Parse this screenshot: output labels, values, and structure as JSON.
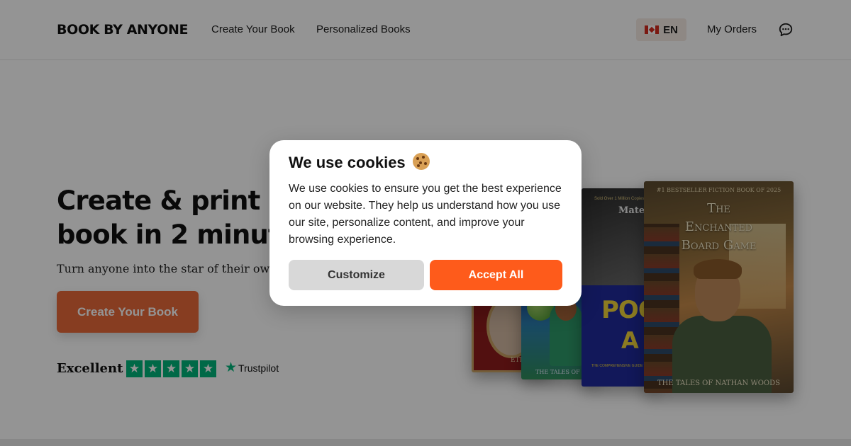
{
  "header": {
    "logo": "BOOK BY ANYONE",
    "nav": [
      "Create Your Book",
      "Personalized Books"
    ],
    "language": "EN",
    "flag_icon": "canada-flag-icon",
    "my_orders": "My Orders",
    "chat_icon": "chat-bubble-icon"
  },
  "hero": {
    "title_line1": "Create & print a h",
    "title_line2": "book in 2 minutes",
    "subtitle": "Turn anyone into the star of their own p",
    "cta_label": "Create Your Book",
    "rating_label": "Excellent",
    "stars": 5,
    "trustpilot": "Trustpilot"
  },
  "books": {
    "red_cover_text": "ETI",
    "space_cover_text": "THE TALES OF",
    "poor_top_line": "Sold Over 1 Million Copies",
    "poor_mate": "Mate",
    "poor_title": "POOI",
    "poor_title_2": "A",
    "poor_small": "THE COMPREHENSIVE GUIDE TO",
    "main_badge": "#1 BESTSELLER FICTION BOOK OF 2025",
    "main_title_1": "The",
    "main_title_2": "Enchanted",
    "main_title_3": "Board Game",
    "main_footer": "THE TALES OF NATHAN WOODS"
  },
  "cookie_modal": {
    "title": "We use cookies",
    "icon": "cookie-icon",
    "body": "We use cookies to ensure you get the best experience on our website. They help us understand how you use our site, personalize content, and improve your browsing experience.",
    "customize_label": "Customize",
    "accept_label": "Accept All"
  },
  "colors": {
    "accent": "#fe5b1b",
    "cta": "#e86a3a",
    "trustpilot_green": "#00b67a"
  }
}
